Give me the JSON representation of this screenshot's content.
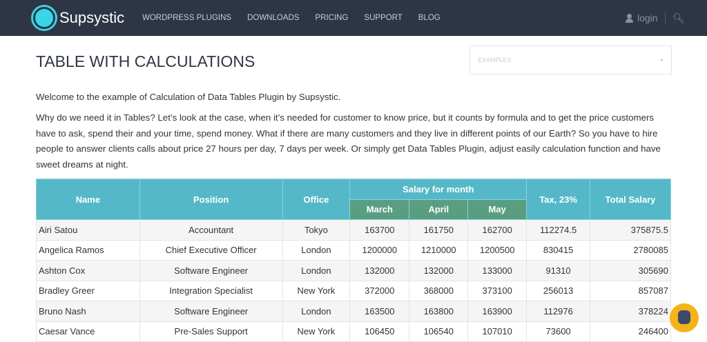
{
  "nav": {
    "brand": "Supsystic",
    "items": [
      "WORDPRESS PLUGINS",
      "DOWNLOADS",
      "PRICING",
      "SUPPORT",
      "BLOG"
    ],
    "login": "login"
  },
  "page": {
    "title": "TABLE WITH CALCULATIONS",
    "select_placeholder": "EXAMPLES",
    "intro": "Welcome to the example of Calculation of Data Tables Plugin by Supsystic.",
    "body": "Why do we need it in Tables? Let’s look at the case, when it’s needed for customer to know price, but it counts by formula and to get the price customers have to ask, spend their and your time, spend money. What if there are many customers and they live in different points of our Earth? So you have to hire people to answer clients calls about price 27 hours per day, 7 days per week. Or simply get Data Tables Plugin, adjust easily calculation function and have sweet dreams at night."
  },
  "table": {
    "headers": {
      "name": "Name",
      "position": "Position",
      "office": "Office",
      "salary": "Salary for month",
      "march": "March",
      "april": "April",
      "may": "May",
      "tax": "Tax, 23%",
      "total": "Total Salary"
    },
    "rows": [
      [
        "Airi Satou",
        "Accountant",
        "Tokyo",
        "163700",
        "161750",
        "162700",
        "112274.5",
        "375875.5"
      ],
      [
        "Angelica Ramos",
        "Chief Executive Officer",
        "London",
        "1200000",
        "1210000",
        "1200500",
        "830415",
        "2780085"
      ],
      [
        "Ashton Cox",
        "Software Engineer",
        "London",
        "132000",
        "132000",
        "133000",
        "91310",
        "305690"
      ],
      [
        "Bradley Greer",
        "Integration Specialist",
        "New York",
        "372000",
        "368000",
        "373100",
        "256013",
        "857087"
      ],
      [
        "Bruno Nash",
        "Software Engineer",
        "London",
        "163500",
        "163800",
        "163900",
        "112976",
        "378224"
      ],
      [
        "Caesar Vance",
        "Pre-Sales Support",
        "New York",
        "106450",
        "106540",
        "107010",
        "73600",
        "246400"
      ]
    ]
  }
}
